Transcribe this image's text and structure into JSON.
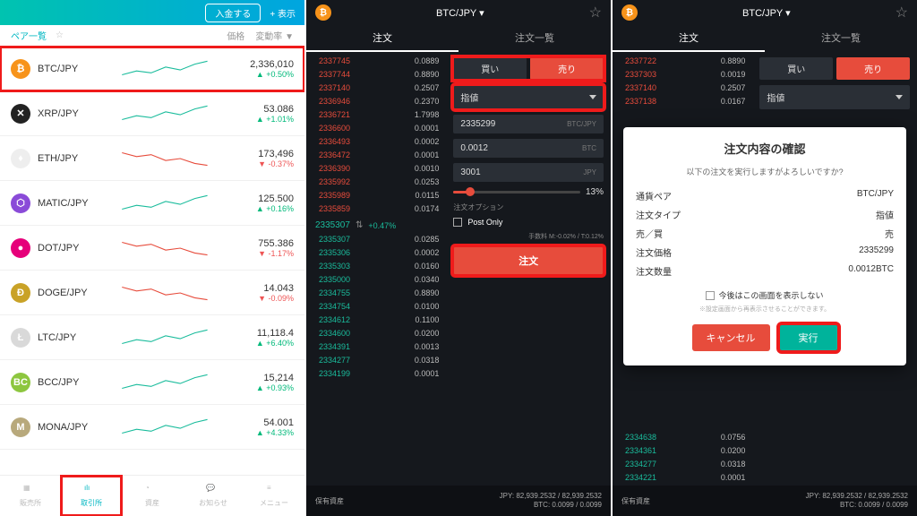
{
  "left": {
    "deposit": "入金する",
    "show": "+ 表示",
    "pair_tab": "ペア一覧",
    "col_price": "価格",
    "col_change": "変動率 ▼",
    "pairs": [
      {
        "sym": "BTC/JPY",
        "price": "2,336,010",
        "chg": "+0.50%",
        "dir": "up",
        "ic": "btc",
        "t": "₿"
      },
      {
        "sym": "XRP/JPY",
        "price": "53.086",
        "chg": "+1.01%",
        "dir": "up",
        "ic": "xrp",
        "t": "✕"
      },
      {
        "sym": "ETH/JPY",
        "price": "173,496",
        "chg": "-0.37%",
        "dir": "dn",
        "ic": "eth",
        "t": "♦"
      },
      {
        "sym": "MATIC/JPY",
        "price": "125.500",
        "chg": "+0.16%",
        "dir": "up",
        "ic": "matic",
        "t": "⬡"
      },
      {
        "sym": "DOT/JPY",
        "price": "755.386",
        "chg": "-1.17%",
        "dir": "dn",
        "ic": "dot",
        "t": "●"
      },
      {
        "sym": "DOGE/JPY",
        "price": "14.043",
        "chg": "-0.09%",
        "dir": "dn",
        "ic": "doge",
        "t": "Ð"
      },
      {
        "sym": "LTC/JPY",
        "price": "11,118.4",
        "chg": "+6.40%",
        "dir": "up",
        "ic": "ltc",
        "t": "Ł"
      },
      {
        "sym": "BCC/JPY",
        "price": "15,214",
        "chg": "+0.93%",
        "dir": "up",
        "ic": "bcc",
        "t": "BC"
      },
      {
        "sym": "MONA/JPY",
        "price": "54.001",
        "chg": "+4.33%",
        "dir": "up",
        "ic": "mona",
        "t": "M"
      }
    ],
    "nav": [
      "販売所",
      "取引所",
      "資産",
      "お知らせ",
      "メニュー"
    ]
  },
  "mid": {
    "title": "BTC/JPY ▾",
    "tab_order": "注文",
    "tab_list": "注文一覧",
    "asks": [
      {
        "p": "2337745",
        "q": "0.0889"
      },
      {
        "p": "2337744",
        "q": "0.8890"
      },
      {
        "p": "2337140",
        "q": "0.2507"
      },
      {
        "p": "2336946",
        "q": "0.2370"
      },
      {
        "p": "2336721",
        "q": "1.7998"
      },
      {
        "p": "2336600",
        "q": "0.0001"
      },
      {
        "p": "2336493",
        "q": "0.0002"
      },
      {
        "p": "2336472",
        "q": "0.0001"
      },
      {
        "p": "2336390",
        "q": "0.0010"
      },
      {
        "p": "2335992",
        "q": "0.0253"
      },
      {
        "p": "2335989",
        "q": "0.0115"
      },
      {
        "p": "2335859",
        "q": "0.0174"
      }
    ],
    "mid_price": "2335307",
    "mid_chg": "+0.47%",
    "bids": [
      {
        "p": "2335307",
        "q": "0.0285"
      },
      {
        "p": "2335306",
        "q": "0.0002"
      },
      {
        "p": "2335303",
        "q": "0.0160"
      },
      {
        "p": "2335000",
        "q": "0.0340"
      },
      {
        "p": "2334755",
        "q": "0.8890"
      },
      {
        "p": "2334754",
        "q": "0.0100"
      },
      {
        "p": "2334612",
        "q": "0.1100"
      },
      {
        "p": "2334600",
        "q": "0.0200"
      },
      {
        "p": "2334391",
        "q": "0.0013"
      },
      {
        "p": "2334277",
        "q": "0.0318"
      },
      {
        "p": "2334199",
        "q": "0.0001"
      }
    ],
    "buy": "買い",
    "sell": "売り",
    "order_type": "指値",
    "price_input": "2335299",
    "price_unit": "BTC/JPY",
    "amount_input": "0.0012",
    "amount_unit": "BTC",
    "total_input": "3001",
    "total_unit": "JPY",
    "slider_pct": "13%",
    "option_label": "注文オプション",
    "post_only": "Post Only",
    "fee": "手数料 M:-0.02% / T:0.12%",
    "submit": "注文",
    "footer_label": "保有資産",
    "footer_jpy": "JPY: 82,939.2532 / 82,939.2532",
    "footer_btc": "BTC: 0.0099 / 0.0099"
  },
  "right": {
    "asks": [
      {
        "p": "2337722",
        "q": "0.8890"
      },
      {
        "p": "2337303",
        "q": "0.0019"
      },
      {
        "p": "2337140",
        "q": "0.2507"
      },
      {
        "p": "2337138",
        "q": "0.0167"
      }
    ],
    "buy": "買い",
    "sell": "売り",
    "order_type": "指値",
    "modal": {
      "title": "注文内容の確認",
      "sub": "以下の注文を実行しますがよろしいですか?",
      "rows": [
        {
          "k": "通貨ペア",
          "v": "BTC/JPY"
        },
        {
          "k": "注文タイプ",
          "v": "指値"
        },
        {
          "k": "売／買",
          "v": "売"
        },
        {
          "k": "注文価格",
          "v": "2335299"
        },
        {
          "k": "注文数量",
          "v": "0.0012BTC"
        }
      ],
      "chk": "今後はこの画面を表示しない",
      "note": "※設定画面から再表示させることができます。",
      "cancel": "キャンセル",
      "exec": "実行"
    },
    "stub": [
      {
        "p": "2334638",
        "q": "0.0756"
      },
      {
        "p": "2334361",
        "q": "0.0200"
      },
      {
        "p": "2334277",
        "q": "0.0318"
      },
      {
        "p": "2334221",
        "q": "0.0001"
      }
    ]
  }
}
